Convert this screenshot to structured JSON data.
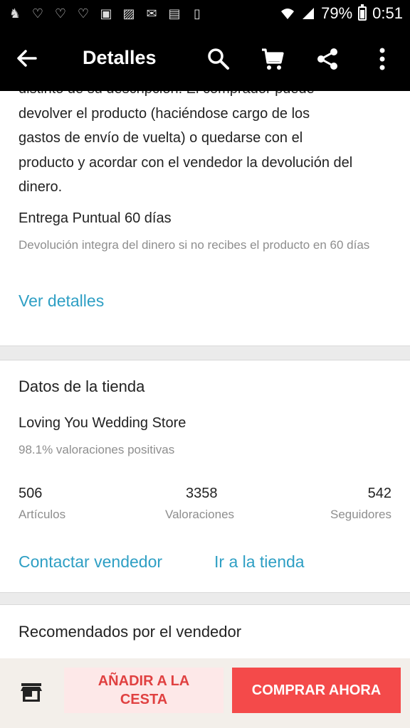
{
  "status_bar": {
    "battery": "79%",
    "time": "0:51"
  },
  "toolbar": {
    "title": "Detalles"
  },
  "description": {
    "text_line_0": "distinto de su descripción. El comprador puede",
    "text_line_1": "devolver el producto (haciéndose cargo de los",
    "text_line_2": "gastos de envío de vuelta) o quedarse con el",
    "text_line_3": "producto y acordar con el vendedor la devolución del",
    "text_line_4": "dinero."
  },
  "delivery": {
    "title": "Entrega Puntual 60 días",
    "subtitle": "Devolución integra del dinero si no recibes el producto en 60 días",
    "details_link": "Ver detalles"
  },
  "store": {
    "section_title": "Datos de la tienda",
    "name": "Loving You Wedding Store",
    "rating": "98.1% valoraciones positivas",
    "stats": [
      {
        "value": "506",
        "label": "Artículos"
      },
      {
        "value": "3358",
        "label": "Valoraciones"
      },
      {
        "value": "542",
        "label": "Seguidores"
      }
    ],
    "contact_label": "Contactar vendedor",
    "store_link": "Ir a la tienda"
  },
  "recommended": {
    "title": "Recomendados por el vendedor"
  },
  "actions": {
    "add_to_cart": "AÑADIR A LA CESTA",
    "buy_now": "COMPRAR AHORA"
  },
  "colors": {
    "accent_link": "#2e9fc4",
    "buy_button": "#f44a4a",
    "add_button_text": "#e04141"
  },
  "icons": [
    "back-arrow-icon",
    "search-icon",
    "cart-icon",
    "share-icon",
    "more-vert-icon",
    "store-icon"
  ]
}
